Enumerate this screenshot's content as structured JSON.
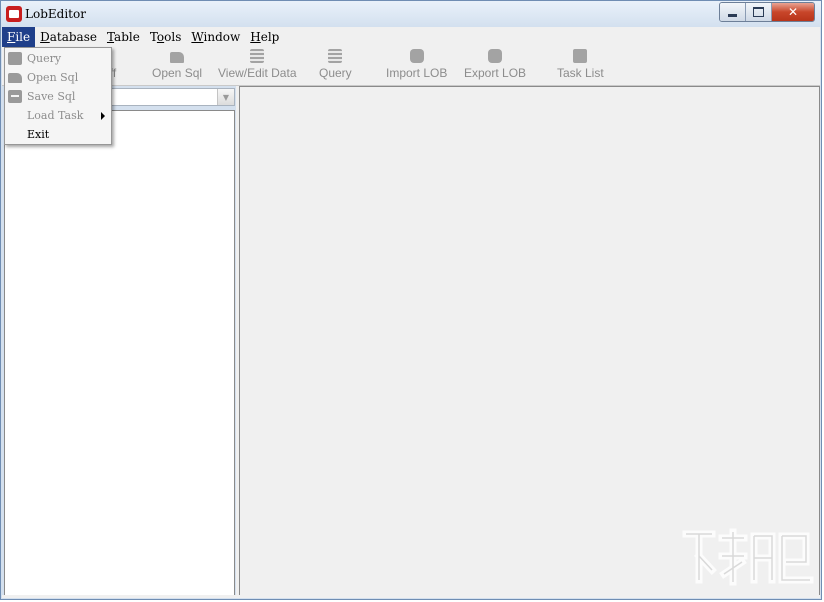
{
  "window": {
    "title": "LobEditor",
    "controls": {
      "minimize": "minimize",
      "maximize": "maximize",
      "close": "✕"
    }
  },
  "menubar": {
    "items": [
      {
        "first": "F",
        "rest": "ile"
      },
      {
        "first": "D",
        "rest": "atabase"
      },
      {
        "first": "T",
        "rest": "able"
      },
      {
        "first": "T",
        "pre": "",
        "rest": "ools",
        "display": "Tools",
        "under_index": 1
      },
      {
        "first": "W",
        "rest": "indow"
      },
      {
        "first": "H",
        "rest": "elp"
      }
    ]
  },
  "toolbar": {
    "buttons": [
      {
        "label": "ff",
        "icon": "logoff-icon"
      },
      {
        "label": "Open Sql",
        "icon": "folder-icon"
      },
      {
        "label": "View/Edit Data",
        "icon": "edit-grid-icon"
      },
      {
        "label": "Query",
        "icon": "query-icon"
      },
      {
        "label": "Import LOB",
        "icon": "import-icon"
      },
      {
        "label": "Export LOB",
        "icon": "export-icon"
      },
      {
        "label": "Task List",
        "icon": "task-list-icon"
      }
    ]
  },
  "file_menu": {
    "items": [
      {
        "label": "Query",
        "enabled": false,
        "icon": "query-icon"
      },
      {
        "label": "Open Sql",
        "enabled": false,
        "icon": "folder-icon"
      },
      {
        "label": "Save Sql",
        "enabled": false,
        "icon": "save-icon"
      },
      {
        "label": "Load Task",
        "enabled": false,
        "submenu": true
      },
      {
        "label": "Exit",
        "enabled": true
      }
    ]
  },
  "left_panel": {
    "combo_value": ""
  },
  "colors": {
    "menu_highlight": "#1f3f8a",
    "disabled_text": "#8d8d8d",
    "panel_background": "#f0f0f0",
    "app_icon": "#c81e1e"
  }
}
